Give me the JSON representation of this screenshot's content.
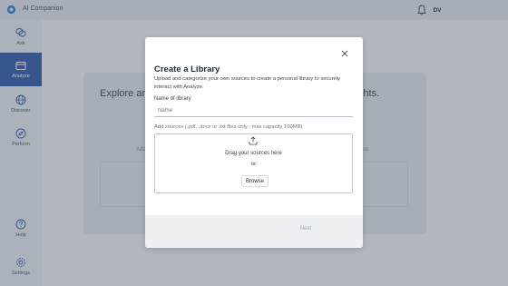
{
  "app": {
    "title": "AI Companion",
    "user_initials": "DV"
  },
  "sidebar": {
    "items": [
      {
        "label": "Ask",
        "icon": "chat-bubbles-icon"
      },
      {
        "label": "Analyze",
        "icon": "library-icon",
        "active": true
      },
      {
        "label": "Discover",
        "icon": "globe-icon"
      },
      {
        "label": "Perform",
        "icon": "compass-icon"
      },
      {
        "label": "Help",
        "icon": "help-icon"
      },
      {
        "label": "Settings",
        "icon": "gear-icon"
      }
    ]
  },
  "background": {
    "heading_left": "Explore and",
    "heading_right": "ble insights.",
    "small_left": "Add",
    "small_right": "more."
  },
  "modal": {
    "title": "Create a Library",
    "subtitle": "Upload and categorize your own sources to create a personal library to securely interact with Analyze.",
    "name_label": "Name of library",
    "name_placeholder": "Name",
    "sources_label": "Add sources (.pdf, .docx or .txt files only : max capacity 100MB)",
    "drag_text": "Drag your sources here",
    "or_text": "or",
    "browse_label": "Browse",
    "next_label": "Next"
  },
  "colors": {
    "accent": "#2d5aa8",
    "background": "#eef1f4"
  }
}
